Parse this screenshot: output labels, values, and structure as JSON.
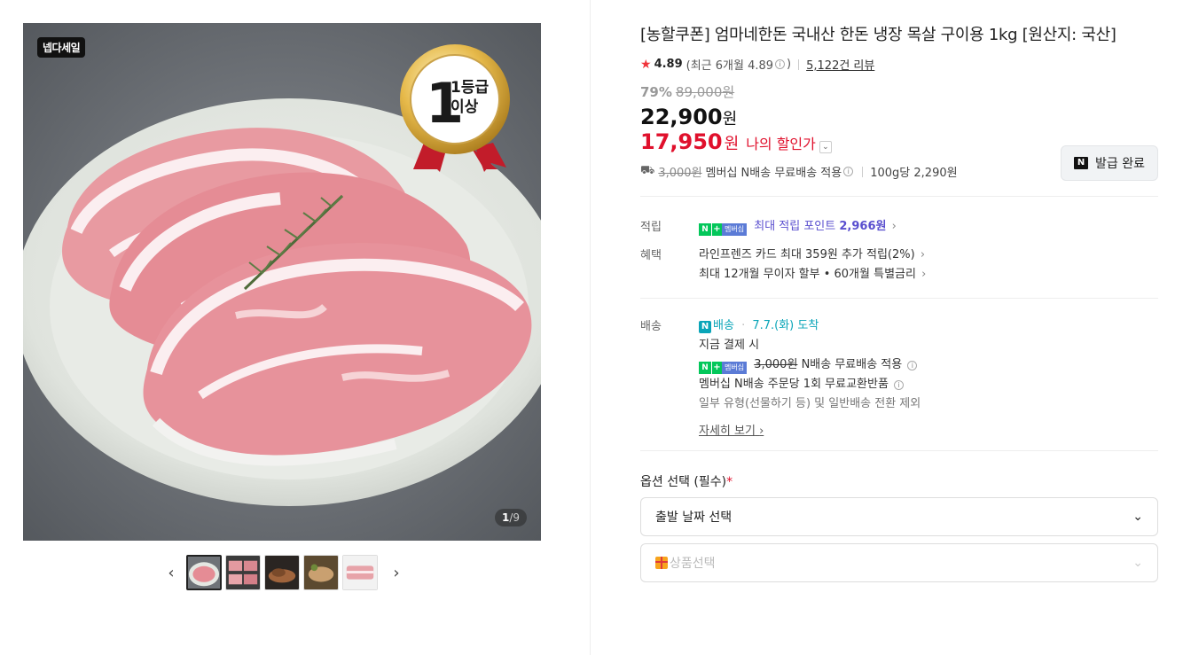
{
  "gallery": {
    "sale_tag": "넵다세일",
    "counter_current": "1",
    "counter_total": "/9",
    "badge_top": "1등급",
    "badge_bottom": "이상",
    "thumb_prev": "‹",
    "thumb_next": "›"
  },
  "product": {
    "title": "[농할쿠폰] 엄마네한돈 국내산 한돈 냉장 목살 구이용 1kg [원산지: 국산]",
    "rating": "4.89",
    "recent_label": "(최근 6개월 4.89",
    "recent_close": ")",
    "reviews": "5,122건 리뷰",
    "discount_rate": "79%",
    "original_price": "89,000원",
    "price": "22,900",
    "price_unit": "원",
    "my_price": "17,950",
    "my_price_unit": "원",
    "my_price_label": "나의 할인가",
    "coupon_button": "발급 완료",
    "shipping_fee": "3,000원",
    "shipping_text": "멤버십 N배송 무료배송 적용",
    "unit_price": "100g당 2,290원"
  },
  "benefits": {
    "points_key": "적립",
    "points_label": "최대 적립 포인트",
    "points_value": "2,966원",
    "benefit_key": "혜택",
    "benefit_line1": "라인프렌즈 카드 최대 359원 추가 적립(2%)",
    "benefit_line2": "최대 12개월 무이자 할부 • 60개월 특별금리"
  },
  "delivery": {
    "key": "배송",
    "n_label": "배송",
    "arrival": "7.7.(화) 도착",
    "line1": "지금 결제 시",
    "fee": "3,000원",
    "line2": "N배송 무료배송 적용",
    "line3": "멤버십 N배송 주문당 1회 무료교환반품",
    "line4": "일부 유형(선물하기 등) 및 일반배송 전환 제외",
    "detail_link": "자세히 보기"
  },
  "options": {
    "title": "옵션 선택 (필수)",
    "required_mark": "*",
    "select1": "출발 날짜 선택",
    "select2": "상품선택"
  },
  "colors": {
    "accent_red": "#e0102c",
    "naver_green": "#03c75a",
    "point_purple": "#5a4fcf",
    "nship_teal": "#0aa5b8"
  }
}
